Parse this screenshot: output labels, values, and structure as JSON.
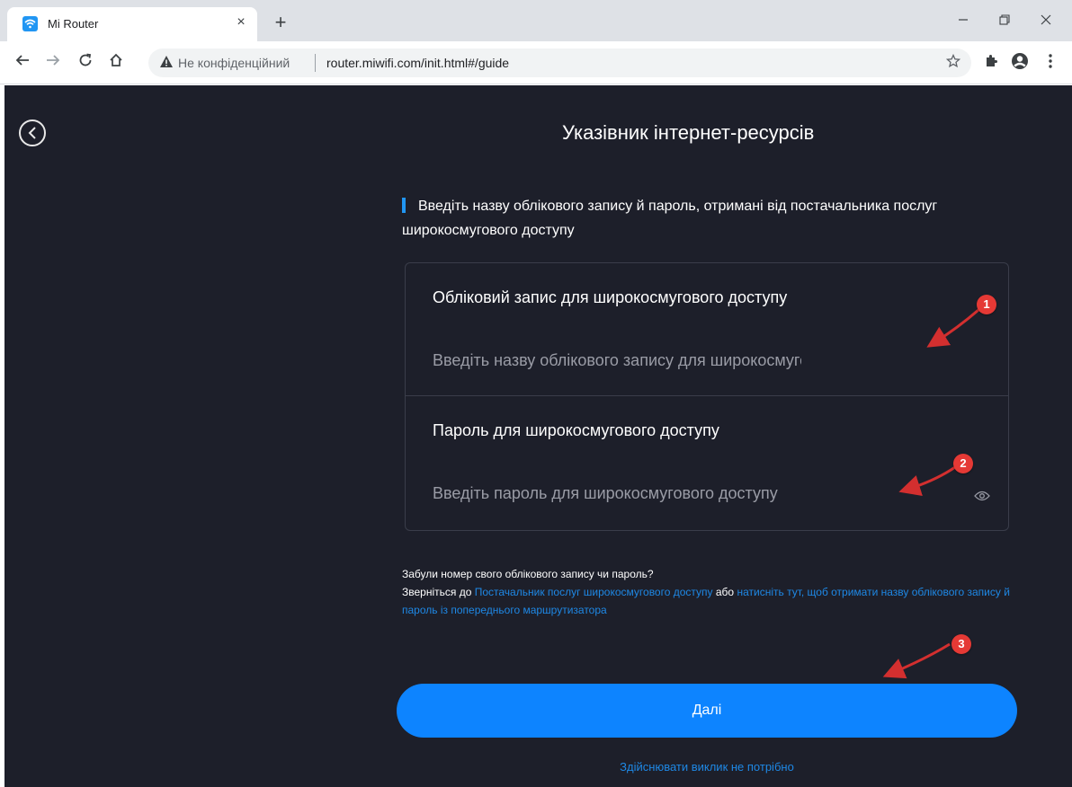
{
  "browser": {
    "tab_title": "Mi Router",
    "tab_close": "×",
    "new_tab": "+",
    "security_label": "Не конфіденційний",
    "url": "router.miwifi.com/init.html#/guide"
  },
  "page": {
    "title": "Указівник інтернет-ресурсів",
    "instruction": "Введіть назву облікового запису й пароль, отримані від постачальника послуг широкосмугового доступу",
    "account_field": {
      "label": "Обліковий запис для широкосмугового доступу",
      "placeholder": "Введіть назву облікового запису для широкосмугового доступу"
    },
    "password_field": {
      "label": "Пароль для широкосмугового доступу",
      "placeholder": "Введіть пароль для широкосмугового доступу"
    },
    "help": {
      "question": "Забули номер свого облікового запису чи пароль?",
      "contact_prefix": "Зверніться до",
      "provider_link": "Постачальник послуг широкосмугового доступу",
      "or": "або",
      "previous_router_link": "натисніть тут, щоб отримати назву облікового запису й пароль із попереднього маршрутизатора"
    },
    "next_button": "Далі",
    "skip_link": "Здійснювати виклик не потрібно"
  },
  "annotations": [
    "1",
    "2",
    "3"
  ],
  "colors": {
    "page_bg": "#1d1f2a",
    "accent": "#0d84ff",
    "link": "#1e88e5",
    "annotation": "#e53935"
  }
}
